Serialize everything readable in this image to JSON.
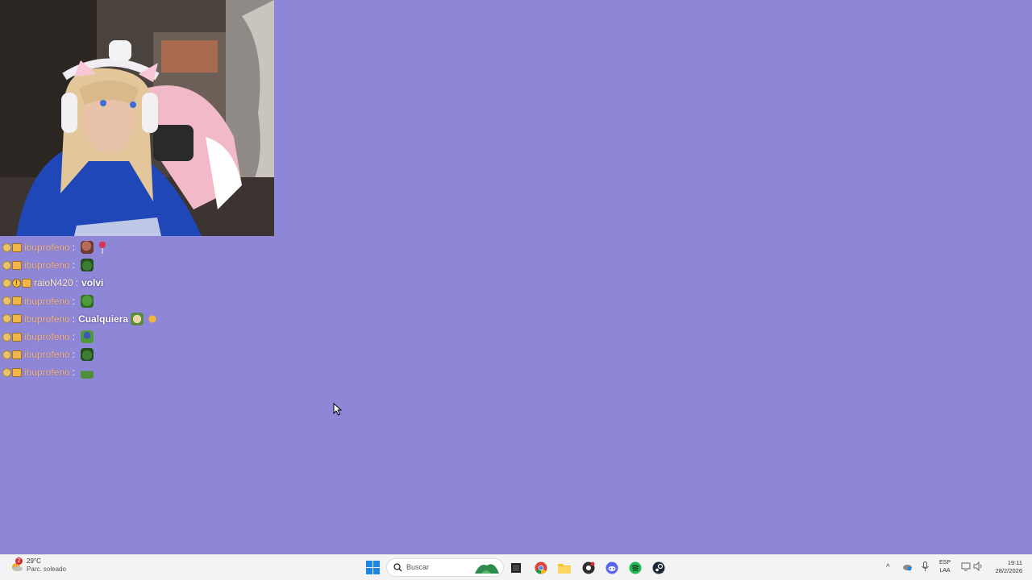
{
  "chat": {
    "messages": [
      {
        "user": "ibuprofeno",
        "text": "",
        "emotes": [
          "face",
          "wine"
        ],
        "alt": false,
        "warn": false
      },
      {
        "user": "ibuprofeno",
        "text": "",
        "emotes": [
          "frog2"
        ],
        "alt": false,
        "warn": false
      },
      {
        "user": "raioN420",
        "text": "volvi",
        "emotes": [],
        "alt": true,
        "warn": true
      },
      {
        "user": "ibuprofeno",
        "text": "",
        "emotes": [
          "frog"
        ],
        "alt": false,
        "warn": false
      },
      {
        "user": "ibuprofeno",
        "text": "Cualquiera",
        "emotes": [
          "bread",
          "hand"
        ],
        "alt": false,
        "warn": false
      },
      {
        "user": "ibuprofeno",
        "text": "",
        "emotes": [
          "frogblue"
        ],
        "alt": false,
        "warn": false
      },
      {
        "user": "ibuprofeno",
        "text": "",
        "emotes": [
          "frog2"
        ],
        "alt": false,
        "warn": false
      },
      {
        "user": "ibuprofeno",
        "text": "",
        "emotes": [
          "frogside"
        ],
        "alt": false,
        "warn": false
      }
    ],
    "separator": ":"
  },
  "taskbar": {
    "weather": {
      "temp": "29°C",
      "desc": "Parc. soleado",
      "badge": "2"
    },
    "search": {
      "placeholder": "Buscar"
    },
    "apps": [
      "start-icon",
      "task-view-icon",
      "chrome-icon",
      "file-explorer-icon",
      "obs-icon",
      "discord-icon",
      "spotify-icon",
      "steam-icon"
    ],
    "tray": {
      "lang_top": "ESP",
      "lang_bottom": "LAA"
    },
    "clock": {
      "time": "19:11",
      "date": "28/2/2026"
    }
  },
  "colors": {
    "desktop": "#8e86d6",
    "username": "#f2b98c",
    "taskbar": "#f3f3f3"
  }
}
